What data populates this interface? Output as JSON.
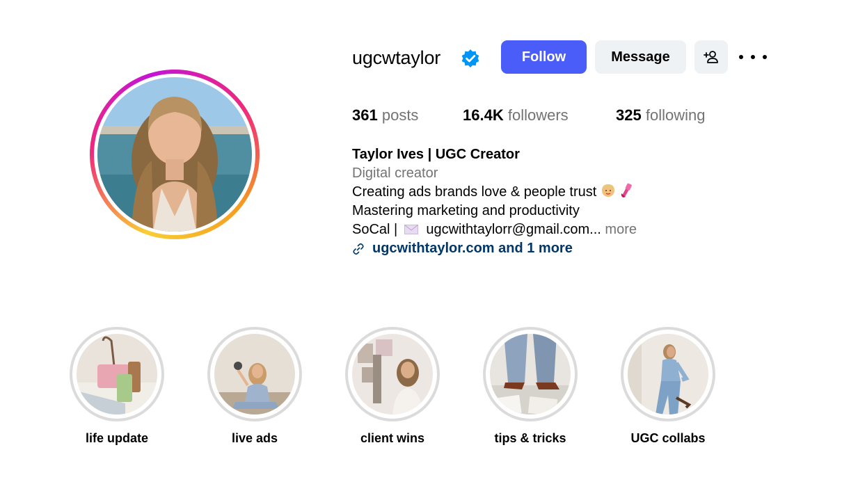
{
  "profile": {
    "username": "ugcwtaylor",
    "verified": true,
    "follow_label": "Follow",
    "message_label": "Message"
  },
  "icons": {
    "verified": "verified-badge-icon",
    "add_user": "add-user-icon",
    "more": "more-options-icon",
    "link": "link-icon",
    "mail": "envelope-icon"
  },
  "stats": {
    "posts_count": "361",
    "posts_label": "posts",
    "followers_count": "16.4K",
    "followers_label": "followers",
    "following_count": "325",
    "following_label": "following"
  },
  "bio": {
    "name": "Taylor Ives | UGC Creator",
    "category": "Digital creator",
    "line1": "Creating ads brands love & people trust",
    "line2": "Mastering marketing and productivity",
    "line3_prefix": "SoCal |",
    "line3_email": "ugcwithtaylorr@gmail.com...",
    "more_label": "more",
    "link_text": "ugcwithtaylor.com and 1 more"
  },
  "highlights": [
    {
      "label": "life update"
    },
    {
      "label": "live ads"
    },
    {
      "label": "client wins"
    },
    {
      "label": "tips & tricks"
    },
    {
      "label": "UGC collabs"
    }
  ],
  "colors": {
    "follow_button": "#4a5df9",
    "secondary_button": "#eff2f5",
    "muted_text": "#737373",
    "link_text": "#00376b",
    "verified_badge": "#0095f6"
  }
}
